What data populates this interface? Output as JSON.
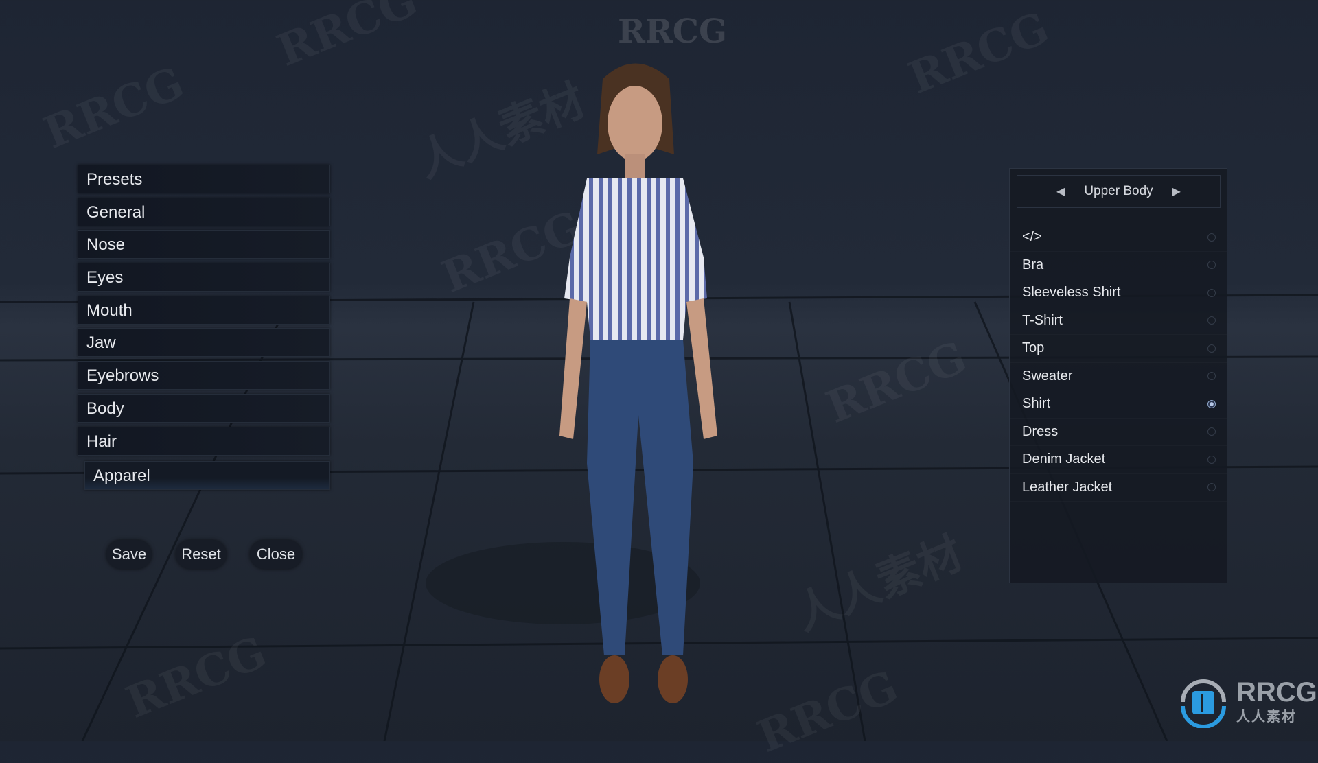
{
  "watermark": "RRCG",
  "watermark_cn": "人人素材",
  "menu": {
    "items": [
      {
        "label": "Presets"
      },
      {
        "label": "General"
      },
      {
        "label": "Nose"
      },
      {
        "label": "Eyes"
      },
      {
        "label": "Mouth"
      },
      {
        "label": "Jaw"
      },
      {
        "label": "Eyebrows"
      },
      {
        "label": "Body"
      },
      {
        "label": "Hair"
      },
      {
        "label": "Apparel",
        "selected": true
      }
    ]
  },
  "actions": {
    "save": "Save",
    "reset": "Reset",
    "close": "Close"
  },
  "apparel_panel": {
    "category": "Upper Body",
    "prev_icon": "triangle-left-icon",
    "next_icon": "triangle-right-icon",
    "items": [
      {
        "label": "</>"
      },
      {
        "label": "Bra"
      },
      {
        "label": "Sleeveless Shirt"
      },
      {
        "label": "T-Shirt"
      },
      {
        "label": "Top"
      },
      {
        "label": "Sweater"
      },
      {
        "label": "Shirt",
        "selected": true
      },
      {
        "label": "Dress"
      },
      {
        "label": "Denim Jacket"
      },
      {
        "label": "Leather Jacket"
      }
    ]
  },
  "logo": {
    "text": "RRCG",
    "subtext": "人人素材"
  },
  "colors": {
    "accent": "#3aa0e0",
    "background": "#1e2533"
  }
}
